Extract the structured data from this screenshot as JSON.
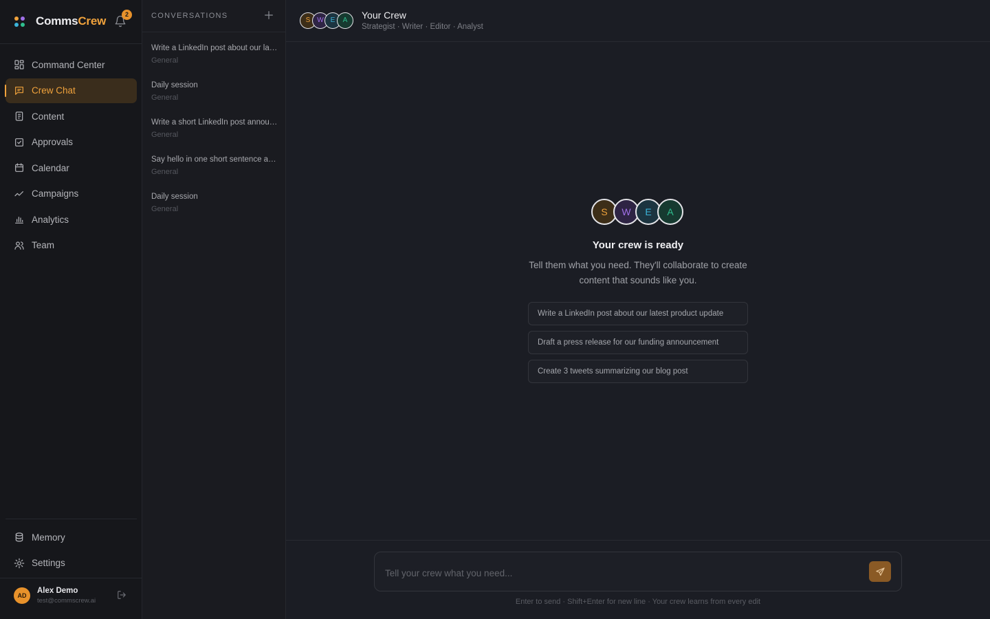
{
  "brand": {
    "name_part1": "Comms",
    "name_part2": "Crew",
    "notification_count": "2",
    "logo_colors": [
      "#f0a23c",
      "#a070e8",
      "#3bb3d9",
      "#2fbf8f"
    ]
  },
  "nav": {
    "items": [
      {
        "label": "Command Center",
        "icon": "dashboard-icon",
        "active": false
      },
      {
        "label": "Crew Chat",
        "icon": "chat-icon",
        "active": true
      },
      {
        "label": "Content",
        "icon": "document-icon",
        "active": false
      },
      {
        "label": "Approvals",
        "icon": "checkbox-icon",
        "active": false
      },
      {
        "label": "Calendar",
        "icon": "calendar-icon",
        "active": false
      },
      {
        "label": "Campaigns",
        "icon": "trend-icon",
        "active": false
      },
      {
        "label": "Analytics",
        "icon": "bar-chart-icon",
        "active": false
      },
      {
        "label": "Team",
        "icon": "users-icon",
        "active": false
      }
    ],
    "bottom": [
      {
        "label": "Memory",
        "icon": "database-icon"
      },
      {
        "label": "Settings",
        "icon": "gear-icon"
      }
    ]
  },
  "user": {
    "initials": "AD",
    "name": "Alex Demo",
    "email": "test@commscrew.ai"
  },
  "conversations": {
    "title": "CONVERSATIONS",
    "items": [
      {
        "title": "Write a LinkedIn post about our latest product update",
        "category": "General"
      },
      {
        "title": "Daily session",
        "category": "General"
      },
      {
        "title": "Write a short LinkedIn post announcing our launch",
        "category": "General"
      },
      {
        "title": "Say hello in one short sentence and introduce yourself",
        "category": "General"
      },
      {
        "title": "Daily session",
        "category": "General"
      }
    ]
  },
  "header": {
    "title": "Your Crew",
    "subtitle": "Strategist · Writer · Editor · Analyst"
  },
  "crew": [
    {
      "initial": "S",
      "role": "Strategist",
      "color": "#f0a23c",
      "bg": "#3d2e18"
    },
    {
      "initial": "W",
      "role": "Writer",
      "color": "#a070e8",
      "bg": "#2e2444"
    },
    {
      "initial": "E",
      "role": "Editor",
      "color": "#3bb3d9",
      "bg": "#1c3440"
    },
    {
      "initial": "A",
      "role": "Analyst",
      "color": "#2fbf8f",
      "bg": "#163a30"
    }
  ],
  "empty_state": {
    "title": "Your crew is ready",
    "description": "Tell them what you need. They'll collaborate to create content that sounds like you.",
    "suggestions": [
      "Write a LinkedIn post about our latest product update",
      "Draft a press release for our funding announcement",
      "Create 3 tweets summarizing our blog post"
    ]
  },
  "composer": {
    "placeholder": "Tell your crew what you need...",
    "hint": "Enter to send · Shift+Enter for new line · Your crew learns from every edit"
  }
}
